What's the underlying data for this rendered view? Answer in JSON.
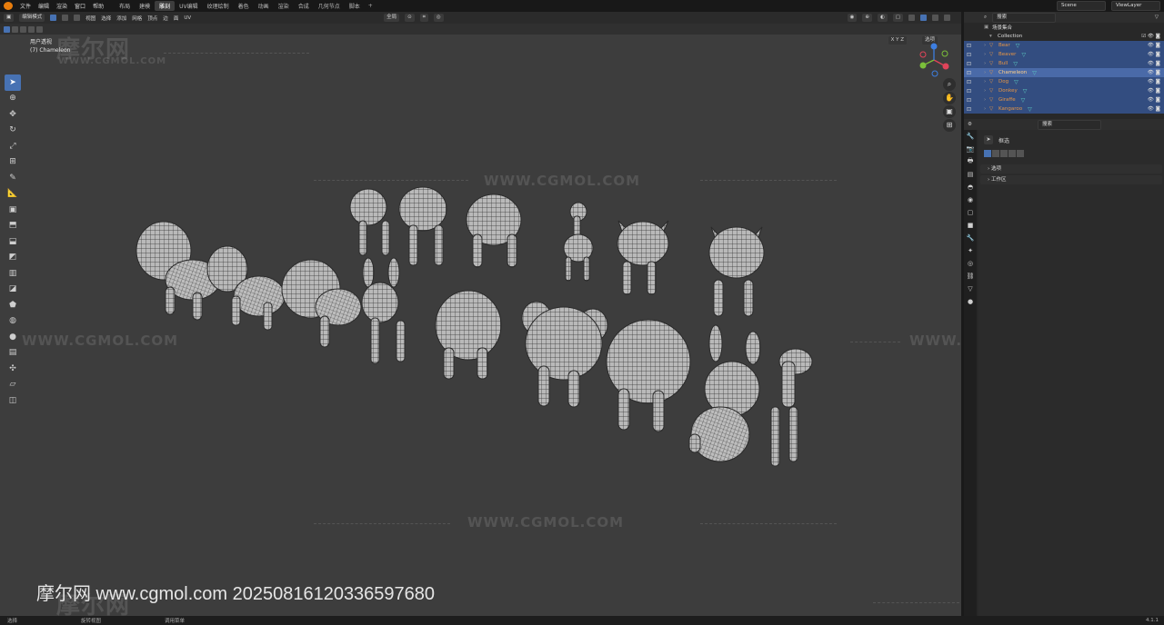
{
  "menubar": {
    "menus": [
      "文件",
      "编辑",
      "渲染",
      "窗口",
      "帮助"
    ],
    "workspaces": [
      "布局",
      "建模",
      "雕刻",
      "UV编辑",
      "纹理绘制",
      "着色",
      "动画",
      "渲染",
      "合成",
      "几何节点",
      "脚本"
    ],
    "active_workspace": "雕刻",
    "scene": "Scene",
    "view_layer": "ViewLayer"
  },
  "viewport_header": {
    "mode": "编辑模式",
    "menus": [
      "视图",
      "选择",
      "添加",
      "网格",
      "顶点",
      "边",
      "面",
      "UV"
    ],
    "transform": "全局",
    "options": "选项",
    "axes": [
      "X",
      "Y",
      "Z"
    ]
  },
  "viewport": {
    "view_name": "用户透视",
    "object_info": "(7) Chameleon"
  },
  "outliner": {
    "title": "场景集合",
    "collection": "Collection",
    "search_placeholder": "搜索",
    "objects": [
      {
        "name": "Bear",
        "state": "selected"
      },
      {
        "name": "Beaver",
        "state": "selected"
      },
      {
        "name": "Bull",
        "state": "selected"
      },
      {
        "name": "Chameleon",
        "state": "active"
      },
      {
        "name": "Dog",
        "state": "selected"
      },
      {
        "name": "Donkey",
        "state": "selected"
      },
      {
        "name": "Giraffe",
        "state": "selected"
      },
      {
        "name": "Kangaroo",
        "state": "selected"
      }
    ]
  },
  "properties": {
    "search_placeholder": "搜索",
    "tool_title": "框选",
    "panels": [
      "选项",
      "工作区"
    ]
  },
  "statusbar": {
    "items": [
      "选择",
      "旋转视图",
      "调用菜单"
    ],
    "version": "4.1.1"
  },
  "watermark": {
    "caption": "摩尔网 www.cgmol.com 20250816120336597680",
    "brand": "摩尔网",
    "url": "WWW.CGMOL.COM"
  },
  "colors": {
    "viewport_bg": "#3d3d3d",
    "accent": "#4772b3",
    "object_orange": "#e59545",
    "mesh_teal": "#5ed4c5"
  }
}
